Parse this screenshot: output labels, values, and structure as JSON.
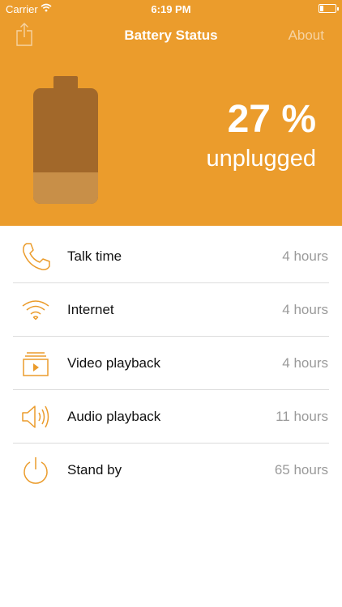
{
  "status_bar": {
    "carrier": "Carrier",
    "time": "6:19 PM",
    "battery_level": 0.2
  },
  "nav": {
    "title": "Battery Status",
    "about_label": "About",
    "share_icon": "share-icon"
  },
  "battery": {
    "percent_text": "27 %",
    "level": 0.27,
    "state": "unplugged"
  },
  "colors": {
    "accent": "#eb9c2c",
    "battery_dark": "#a2682a",
    "battery_fill": "#c88f48",
    "value_gray": "#9a9a9a"
  },
  "usage": [
    {
      "icon": "phone-icon",
      "label": "Talk time",
      "value": "4 hours"
    },
    {
      "icon": "wifi-icon",
      "label": "Internet",
      "value": "4 hours"
    },
    {
      "icon": "video-icon",
      "label": "Video playback",
      "value": "4 hours"
    },
    {
      "icon": "speaker-icon",
      "label": "Audio playback",
      "value": "11 hours"
    },
    {
      "icon": "power-icon",
      "label": "Stand by",
      "value": "65 hours"
    }
  ]
}
